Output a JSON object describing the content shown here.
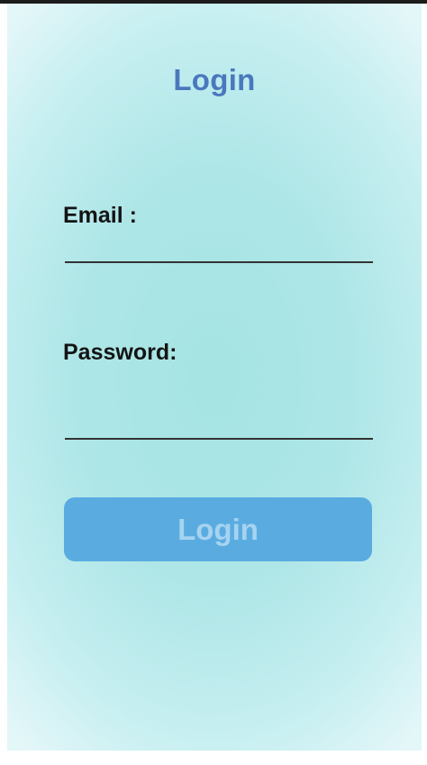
{
  "header": {
    "title": "Login"
  },
  "form": {
    "email": {
      "label": "Email :",
      "value": "",
      "placeholder": ""
    },
    "password": {
      "label": "Password:",
      "value": "",
      "placeholder": ""
    },
    "submit_label": "Login"
  },
  "colors": {
    "title": "#4a78be",
    "button": "#5aace0",
    "button_text": "#a6d3f1",
    "background_center": "#a5e4e3",
    "background_edge": "#e3f6f8"
  }
}
